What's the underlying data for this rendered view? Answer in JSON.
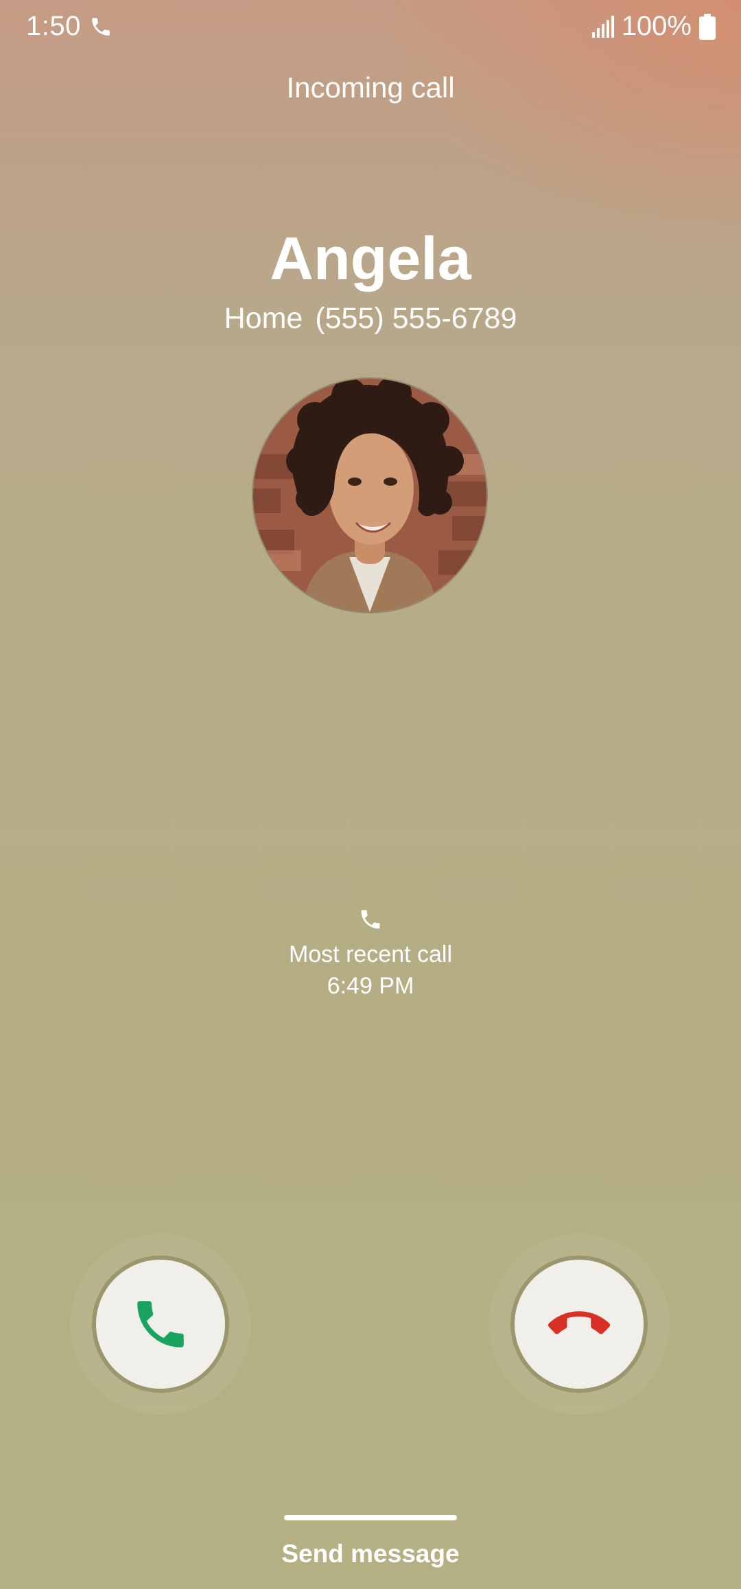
{
  "status_bar": {
    "time": "1:50",
    "battery": "100%",
    "icons": [
      "phone-icon",
      "signal-icon",
      "battery-icon"
    ]
  },
  "call": {
    "state_label": "Incoming call",
    "caller_name": "Angela",
    "number_type": "Home",
    "number": "(555) 555-6789",
    "avatar": "caller-photo"
  },
  "recent": {
    "icon": "phone-icon",
    "label": "Most recent call",
    "time": "6:49 PM"
  },
  "actions": {
    "accept_icon": "phone-answer-icon",
    "decline_icon": "phone-hangup-icon",
    "accept_color": "#1aa260",
    "decline_color": "#d93025",
    "send_message_label": "Send message"
  }
}
